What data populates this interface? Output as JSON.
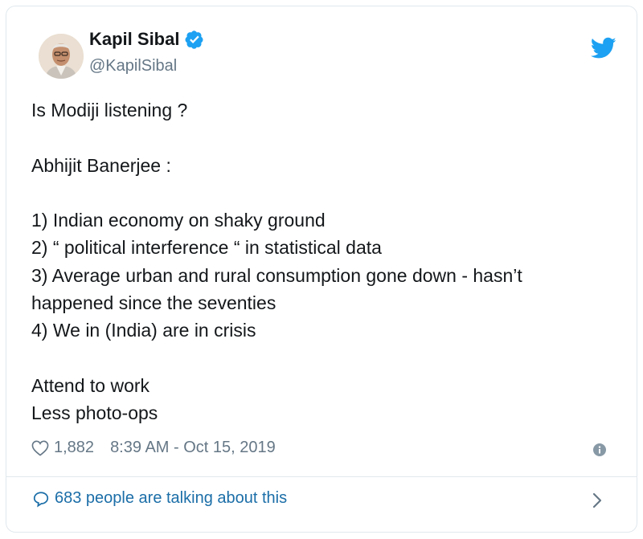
{
  "author": {
    "name": "Kapil Sibal",
    "handle": "@KapilSibal",
    "verified": true
  },
  "tweet": {
    "lines": [
      "Is Modiji listening ?",
      "",
      "Abhijit Banerjee :",
      "",
      "1) Indian economy on shaky ground",
      "2) “ political interference “ in statistical data",
      "3) Average urban and rural consumption gone down - hasn’t",
      "happened since the seventies",
      "4) We in (India) are in crisis",
      "",
      "Attend to work",
      "Less photo-ops"
    ]
  },
  "meta": {
    "likes": "1,882",
    "timestamp": "8:39 AM - Oct 15, 2019"
  },
  "footer": {
    "talking": "683 people are talking about this"
  },
  "icons": {
    "brand": "twitter-bird-icon",
    "verified": "verified-badge-icon",
    "like": "heart-icon",
    "info": "info-icon",
    "reply": "speech-bubble-icon",
    "chevron": "chevron-right-icon"
  },
  "colors": {
    "twitter_blue": "#1da1f2",
    "link_blue": "#1b6ea8",
    "muted": "#657786",
    "text": "#14171a",
    "border": "#e1e8ed"
  }
}
